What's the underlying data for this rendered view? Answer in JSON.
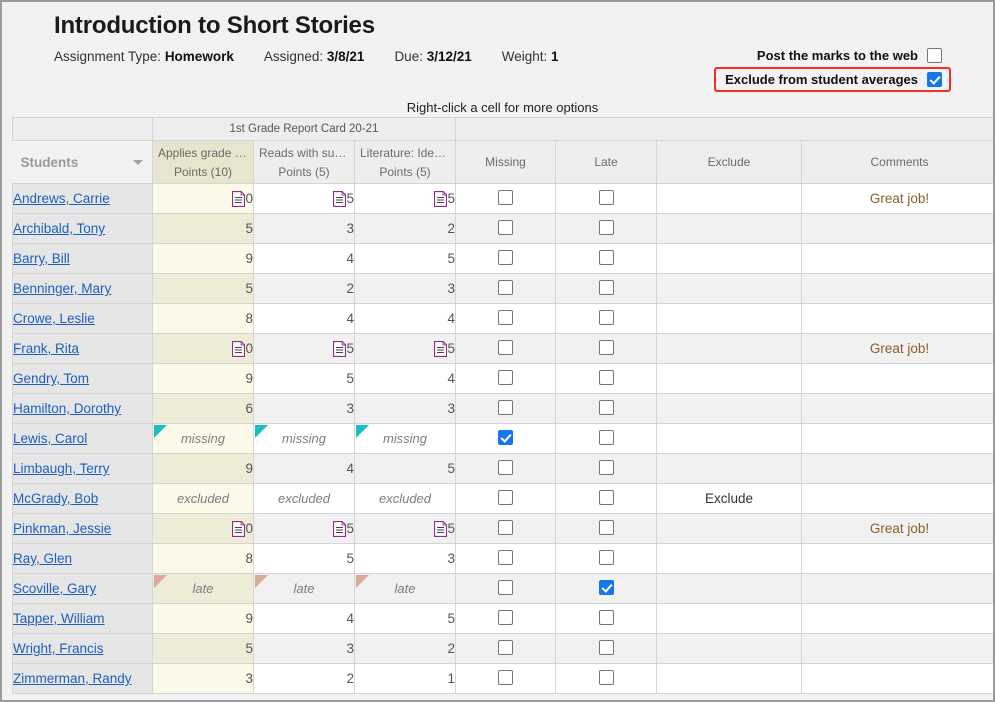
{
  "header": {
    "title": "Introduction to Short Stories",
    "meta": [
      {
        "label": "Assignment Type:",
        "value": "Homework"
      },
      {
        "label": "Assigned:",
        "value": "3/8/21"
      },
      {
        "label": "Due:",
        "value": "3/12/21"
      },
      {
        "label": "Weight:",
        "value": "1"
      }
    ]
  },
  "options": {
    "post_marks_label": "Post the marks to the web",
    "post_marks_checked": false,
    "exclude_averages_label": "Exclude from student averages",
    "exclude_averages_checked": true,
    "highlight_color": "#ee3124"
  },
  "hint": "Right-click a cell for more options",
  "table": {
    "group_header": "1st Grade Report Card 20-21",
    "students_header": "Students",
    "columns": [
      {
        "top": "Applies grade lev…",
        "bottom": "Points (10)",
        "selected": true
      },
      {
        "top": "Reads with suffic…",
        "bottom": "Points (5)",
        "selected": false
      },
      {
        "top": "Literature: Identif…",
        "bottom": "Points (5)",
        "selected": false
      }
    ],
    "extra_columns": [
      "Missing",
      "Late",
      "Exclude",
      "Comments"
    ],
    "rows": [
      {
        "student": "Andrews, Carrie",
        "g1": "10",
        "g2": "5",
        "g3": "5",
        "note1": true,
        "note2": true,
        "note3": true,
        "flag": "",
        "missing": false,
        "late": false,
        "exclude": "",
        "comment": "Great job!"
      },
      {
        "student": "Archibald, Tony",
        "g1": "5",
        "g2": "3",
        "g3": "2",
        "note1": false,
        "note2": false,
        "note3": false,
        "flag": "",
        "missing": false,
        "late": false,
        "exclude": "",
        "comment": ""
      },
      {
        "student": "Barry, Bill",
        "g1": "9",
        "g2": "4",
        "g3": "5",
        "note1": false,
        "note2": false,
        "note3": false,
        "flag": "",
        "missing": false,
        "late": false,
        "exclude": "",
        "comment": ""
      },
      {
        "student": "Benninger, Mary",
        "g1": "5",
        "g2": "2",
        "g3": "3",
        "note1": false,
        "note2": false,
        "note3": false,
        "flag": "",
        "missing": false,
        "late": false,
        "exclude": "",
        "comment": ""
      },
      {
        "student": "Crowe, Leslie",
        "g1": "8",
        "g2": "4",
        "g3": "4",
        "note1": false,
        "note2": false,
        "note3": false,
        "flag": "",
        "missing": false,
        "late": false,
        "exclude": "",
        "comment": ""
      },
      {
        "student": "Frank, Rita",
        "g1": "10",
        "g2": "5",
        "g3": "5",
        "note1": true,
        "note2": true,
        "note3": true,
        "flag": "",
        "missing": false,
        "late": false,
        "exclude": "",
        "comment": "Great job!"
      },
      {
        "student": "Gendry, Tom",
        "g1": "9",
        "g2": "5",
        "g3": "4",
        "note1": false,
        "note2": false,
        "note3": false,
        "flag": "",
        "missing": false,
        "late": false,
        "exclude": "",
        "comment": ""
      },
      {
        "student": "Hamilton, Dorothy",
        "g1": "6",
        "g2": "3",
        "g3": "3",
        "note1": false,
        "note2": false,
        "note3": false,
        "flag": "",
        "missing": false,
        "late": false,
        "exclude": "",
        "comment": ""
      },
      {
        "student": "Lewis, Carol",
        "g1": "missing",
        "g2": "missing",
        "g3": "missing",
        "note1": false,
        "note2": false,
        "note3": false,
        "flag": "missing",
        "missing": true,
        "late": false,
        "exclude": "",
        "comment": ""
      },
      {
        "student": "Limbaugh, Terry",
        "g1": "9",
        "g2": "4",
        "g3": "5",
        "note1": false,
        "note2": false,
        "note3": false,
        "flag": "",
        "missing": false,
        "late": false,
        "exclude": "",
        "comment": ""
      },
      {
        "student": "McGrady, Bob",
        "g1": "excluded",
        "g2": "excluded",
        "g3": "excluded",
        "note1": false,
        "note2": false,
        "note3": false,
        "flag": "excluded",
        "missing": false,
        "late": false,
        "exclude": "Exclude",
        "comment": ""
      },
      {
        "student": "Pinkman, Jessie",
        "g1": "10",
        "g2": "5",
        "g3": "5",
        "note1": true,
        "note2": true,
        "note3": true,
        "flag": "",
        "missing": false,
        "late": false,
        "exclude": "",
        "comment": "Great job!"
      },
      {
        "student": "Ray, Glen",
        "g1": "8",
        "g2": "5",
        "g3": "3",
        "note1": false,
        "note2": false,
        "note3": false,
        "flag": "",
        "missing": false,
        "late": false,
        "exclude": "",
        "comment": ""
      },
      {
        "student": "Scoville, Gary",
        "g1": "late",
        "g2": "late",
        "g3": "late",
        "note1": false,
        "note2": false,
        "note3": false,
        "flag": "late",
        "missing": false,
        "late": true,
        "exclude": "",
        "comment": ""
      },
      {
        "student": "Tapper, William",
        "g1": "9",
        "g2": "4",
        "g3": "5",
        "note1": false,
        "note2": false,
        "note3": false,
        "flag": "",
        "missing": false,
        "late": false,
        "exclude": "",
        "comment": ""
      },
      {
        "student": "Wright, Francis",
        "g1": "5",
        "g2": "3",
        "g3": "2",
        "note1": false,
        "note2": false,
        "note3": false,
        "flag": "",
        "missing": false,
        "late": false,
        "exclude": "",
        "comment": ""
      },
      {
        "student": "Zimmerman, Randy",
        "g1": "3",
        "g2": "2",
        "g3": "1",
        "note1": false,
        "note2": false,
        "note3": false,
        "flag": "",
        "missing": false,
        "late": false,
        "exclude": "",
        "comment": ""
      }
    ]
  }
}
